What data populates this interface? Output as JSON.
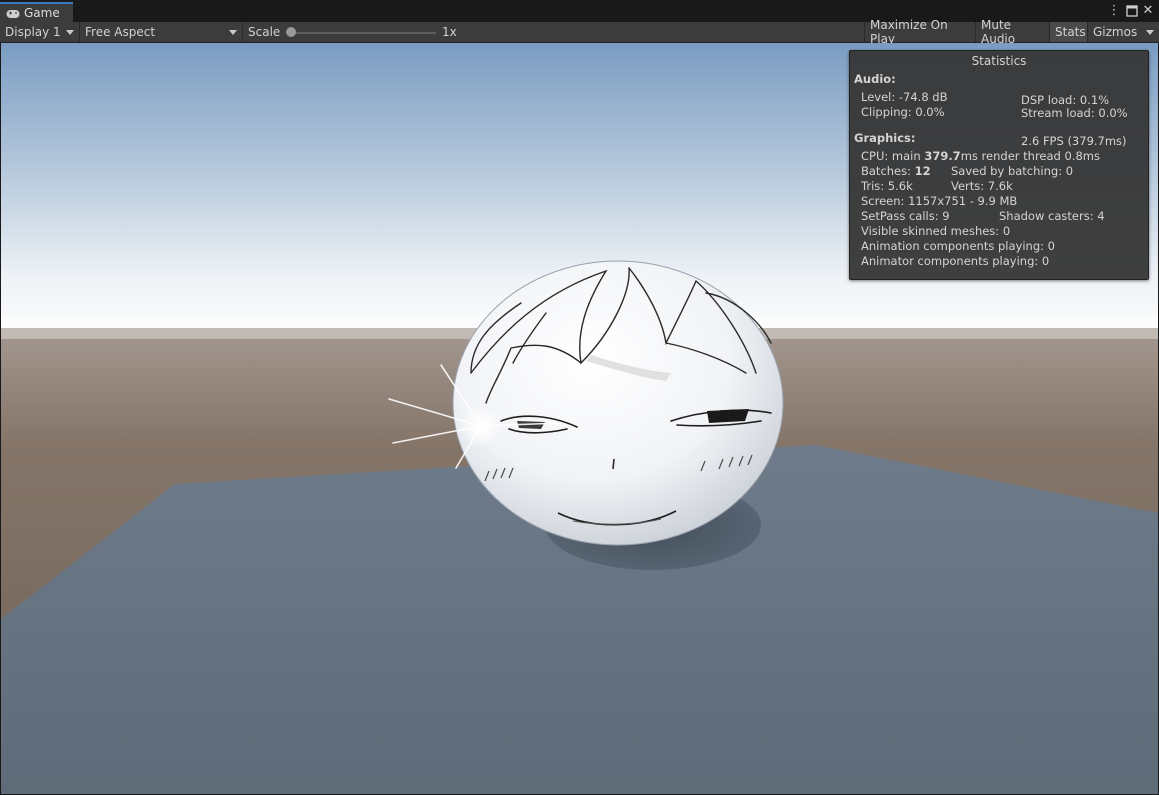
{
  "window": {
    "tab_label": "Game",
    "tab_icon": "gamepad-icon",
    "menu_icon": "more-vert-icon",
    "maximize_icon": "maximize-icon",
    "close_icon": "close-icon"
  },
  "toolbar": {
    "display_label": "Display 1",
    "aspect_label": "Free Aspect",
    "scale_label": "Scale",
    "scale_value": "1x",
    "scale_level": 0.0,
    "maximize_on_play": "Maximize On Play",
    "mute_audio": "Mute Audio",
    "stats": "Stats",
    "gizmos": "Gizmos"
  },
  "stats": {
    "title": "Statistics",
    "audio_heading": "Audio:",
    "level": "Level: -74.8 dB",
    "clipping": "Clipping: 0.0%",
    "dsp_load": "DSP load: 0.1%",
    "stream_load": "Stream load: 0.0%",
    "graphics_heading": "Graphics:",
    "fps": "2.6 FPS (379.7ms)",
    "cpu_prefix": "CPU: main ",
    "cpu_main_value": "379.7",
    "cpu_suffix": "ms  render thread 0.8ms",
    "batches_prefix": "Batches: ",
    "batches_value": "12",
    "saved_by_batching": "Saved by batching: 0",
    "tris": "Tris: 5.6k",
    "verts": "Verts: 7.6k",
    "screen": "Screen: 1157x751 - 9.9 MB",
    "setpass": "SetPass calls: 9",
    "shadow_casters": "Shadow casters: 4",
    "visible_skinned": "Visible skinned meshes: 0",
    "animation_components": "Animation components playing: 0",
    "animator_components": "Animator components playing: 0"
  },
  "colors": {
    "sky_top": "#7fa0c4",
    "sky_horizon": "#f4f6f8",
    "ground": "#8a7a70",
    "floor_plane": "#66727f",
    "tab_accent": "#3a79bb"
  }
}
